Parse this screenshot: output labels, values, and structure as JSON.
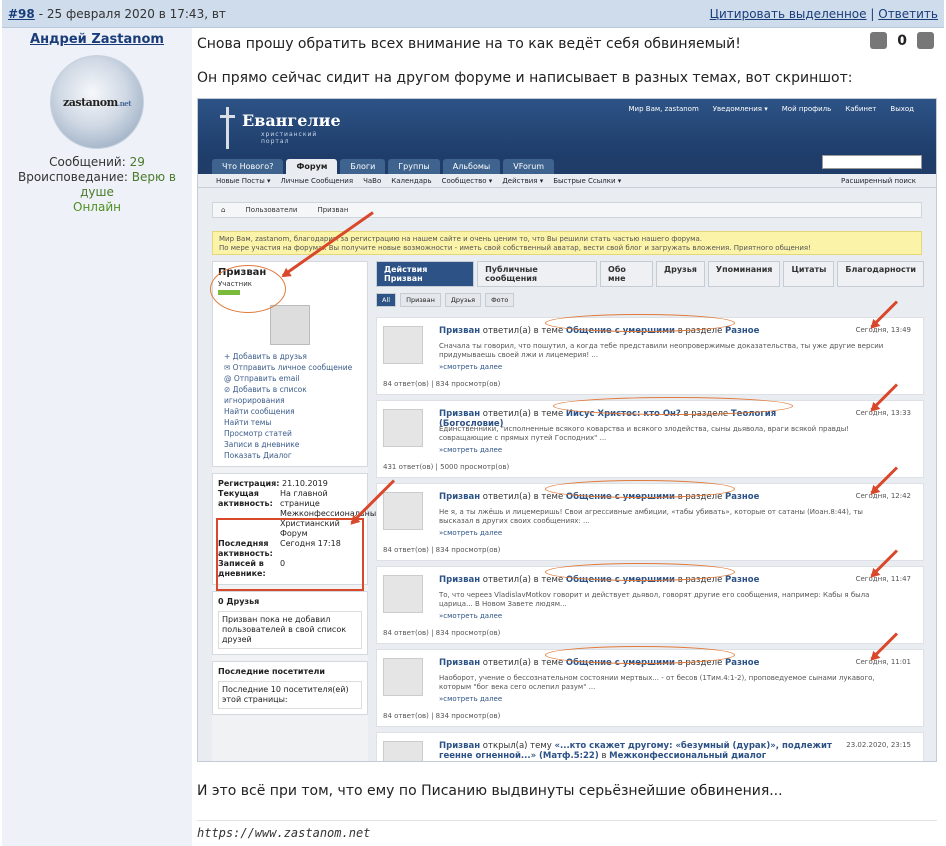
{
  "header": {
    "post_number": "#98",
    "date": "- 25 февраля 2020 в 17:43, вт",
    "quote_selected": "Цитировать выделенное",
    "separator": "|",
    "reply": "Ответить"
  },
  "author": {
    "name": "Андрей Zastanom",
    "avatar_text": "zastanom",
    "avatar_subtext": ".net",
    "messages_label": "Сообщений:",
    "messages_value": "29",
    "religion_label": "Вроисповедание:",
    "religion_value": "Верю в душе",
    "status": "Онлайн"
  },
  "message": {
    "paragraph1": "Снова прошу обратить всех внимание на то как ведёт себя обвиняемый!",
    "paragraph2": "Он прямо сейчас сидит на другом форуме и написывает в разных темах, вот скриншот:",
    "paragraph3": "И это всё при том, что ему по Писанию выдвинуты серьёзнейшие обвинения...",
    "signature": "https://www.zastanom.net",
    "vote_count": "0"
  },
  "screenshot": {
    "logo_title": "Евангелие",
    "logo_subtitle": "христианский портал",
    "top_links": [
      "Мир Вам, zastanom",
      "Уведомления ▾",
      "Мой профиль",
      "Кабинет",
      "Выход"
    ],
    "nav": [
      "Что Нового?",
      "Форум",
      "Блоги",
      "Группы",
      "Альбомы",
      "VForum"
    ],
    "subnav": [
      "Новые Посты ▾",
      "Личные Сообщения",
      "ЧаВо",
      "Календарь",
      "Сообщество ▾",
      "Действия ▾",
      "Быстрые Ссылки ▾"
    ],
    "subnav_right": "Расширенный поиск",
    "breadcrumb": [
      "⌂",
      "Пользователи",
      "Призван"
    ],
    "notice_line1": "Мир Вам, zastanom, благодарим за регистрацию на нашем сайте и очень ценим то, что Вы решили стать частью нашего форума.",
    "notice_line2": "По мере участия на форумах Вы получите новые возможности - иметь свой собственный аватар, вести свой блог и загружать вложения. Приятного общения!",
    "profile_name": "Призван",
    "profile_role": "Участник",
    "profile_links": [
      "+ Добавить в друзья",
      "✉ Отправить личное сообщение",
      "@ Отправить email",
      "⊘ Добавить в список игнорирования",
      "Найти сообщения",
      "Найти темы",
      "Просмотр статей",
      "Записи в дневнике",
      "Показать Диалог"
    ],
    "reg_label": "Регистрация:",
    "reg_value": "21.10.2019",
    "cur_label": "Текущая активность:",
    "cur_value": "На главной странице Межконфессиональный Христианский Форум",
    "last_label": "Последняя активность:",
    "last_value": "Сегодня 17:18",
    "diary_label": "Записей в дневнике:",
    "diary_value": "0",
    "friends_title": "0 Друзья",
    "friends_text": "Призван пока не добавил пользователей в свой список друзей",
    "visitors_title": "Последние посетители",
    "visitors_text": "Последние 10 посетителя(ей) этой страницы:",
    "tabs": [
      "Действия Призван",
      "Публичные сообщения",
      "Обо мне",
      "Друзья",
      "Упоминания",
      "Цитаты",
      "Благодарности"
    ],
    "filters": [
      "All",
      "Призван",
      "Друзья",
      "Фото"
    ],
    "activities": [
      {
        "user": "Призван",
        "verb": "ответил(а) в теме",
        "topic": "Общение с умершими",
        "in": "в разделе",
        "section": "Разное",
        "time": "Сегодня, 13:49",
        "excerpt": "Сначала ты говорил, что пошутил, а когда тебе представили неопровержимые доказательства, ты уже другие версии придумываешь своей лжи и лицемерия! ...",
        "more": "»смотреть далее",
        "stats": "84 ответ(ов) | 834 просмотр(ов)"
      },
      {
        "user": "Призван",
        "verb": "ответил(а) в теме",
        "topic": "Иисус Христос: кто Он?",
        "in": "в разделе",
        "section": "Теология (Богословие)",
        "time": "Сегодня, 13:33",
        "excerpt": "Единственники, \"исполненные всякого коварства и всякого злодейства, сыны дьявола, враги всякой правды! совращающие с прямых путей Господних\" ...",
        "more": "»смотреть далее",
        "stats": "431 ответ(ов) | 5000 просмотр(ов)"
      },
      {
        "user": "Призван",
        "verb": "ответил(а) в теме",
        "topic": "Общение с умершими",
        "in": "в разделе",
        "section": "Разное",
        "time": "Сегодня, 12:42",
        "excerpt": "Не я, а ты лжёшь и лицемеришь! Свои агрессивные амбиции, «табы убивать», которые от сатаны (Иоан.8:44), ты высказал в других своих сообщениях: ...",
        "more": "»смотреть далее",
        "stats": "84 ответ(ов) | 834 просмотр(ов)"
      },
      {
        "user": "Призван",
        "verb": "ответил(а) в теме",
        "topic": "Общение с умершими",
        "in": "в разделе",
        "section": "Разное",
        "time": "Сегодня, 11:47",
        "excerpt": "То, что череез VladislavMotkov говорит и действует дьявол, говорят другие его сообщения, например: Кабы я была царица... В Новом Завете людям...",
        "more": "»смотреть далее",
        "stats": "84 ответ(ов) | 834 просмотр(ов)"
      },
      {
        "user": "Призван",
        "verb": "ответил(а) в теме",
        "topic": "Общение с умершими",
        "in": "в разделе",
        "section": "Разное",
        "time": "Сегодня, 11:01",
        "excerpt": "Наоборот, учение о бессознательном состоянии мертвых... - от бесов (1Тим.4:1-2), проповедуемое сынами лукавого, которым \"бог века сего ослепил разум\" ...",
        "more": "»смотреть далее",
        "stats": "84 ответ(ов) | 834 просмотр(ов)"
      },
      {
        "user": "Призван",
        "verb": "открыл(а) тему",
        "topic": "«...кто скажет другому: «безумный (дурак)», подлежит геенне огненной...» (Матф.5:22)",
        "in": "в",
        "section": "Межконфессиональный диалог",
        "time": "23.02.2020, 23:15",
        "excerpt": "",
        "more": "",
        "stats": ""
      }
    ]
  },
  "colors": {
    "header_bg": "#cfdcec",
    "sidebar_bg": "#eef2f8",
    "link": "#1a3d7a",
    "online": "#4f8f22",
    "annotation": "#d9482b"
  }
}
